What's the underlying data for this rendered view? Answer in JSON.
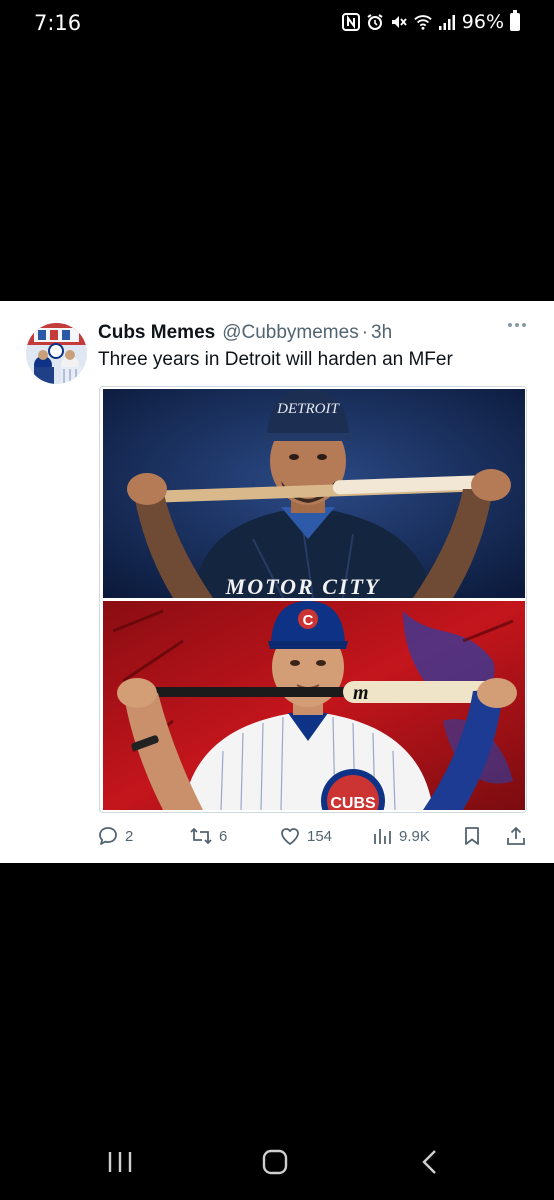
{
  "status_bar": {
    "time": "7:16",
    "battery": "96%",
    "icons": [
      "nfc-icon",
      "alarm-icon",
      "mute-icon",
      "wifi-icon",
      "signal-icon",
      "battery-icon"
    ]
  },
  "tweet": {
    "display_name": "Cubs Memes",
    "handle": "@Cubbymemes",
    "separator": "·",
    "time": "3h",
    "text": "Three years in Detroit will harden an MFer",
    "media": {
      "top_cap_text": "DETROIT",
      "top_jersey_text": "MOTOR CITY",
      "bottom_cap_text": "C",
      "bottom_logo_text": "CUBS",
      "bat_brand": "m"
    },
    "actions": {
      "replies": "2",
      "retweets": "6",
      "likes": "154",
      "views": "9.9K"
    }
  },
  "colors": {
    "background": "#000000",
    "card": "#ffffff",
    "text_primary": "#0f1419",
    "text_secondary": "#536471",
    "detroit_navy": "#14253f",
    "cubs_blue": "#0e3386",
    "cubs_red": "#cc3433"
  }
}
